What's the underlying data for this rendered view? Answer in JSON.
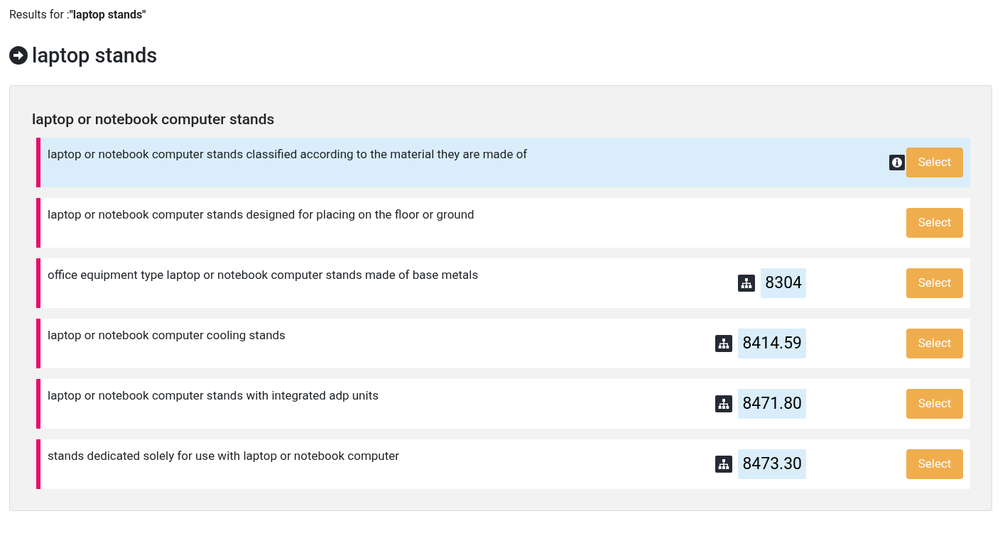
{
  "query_line": "Results for :**\"laptop stands\"**",
  "heading": "laptop stands",
  "group": {
    "title": "laptop or notebook computer stands",
    "rows": [
      {
        "text": "laptop or notebook computer stands classified according to the material they are made of",
        "highlighted": true,
        "info": true,
        "button": "Select"
      },
      {
        "text": "laptop or notebook computer stands designed for placing on the floor or ground",
        "highlighted": false,
        "info": false,
        "button": "Select"
      },
      {
        "text": "office equipment type laptop or notebook computer stands made of base metals",
        "highlighted": false,
        "info": false,
        "code": "8304",
        "button": "Select"
      },
      {
        "text": "laptop or notebook computer cooling stands",
        "highlighted": false,
        "info": false,
        "code": "8414.59",
        "button": "Select"
      },
      {
        "text": "laptop or notebook computer stands with integrated adp units",
        "highlighted": false,
        "info": false,
        "code": "8471.80",
        "button": "Select"
      },
      {
        "text": "stands dedicated solely for use with laptop or notebook computer",
        "highlighted": false,
        "info": false,
        "code": "8473.30",
        "button": "Select"
      }
    ]
  }
}
